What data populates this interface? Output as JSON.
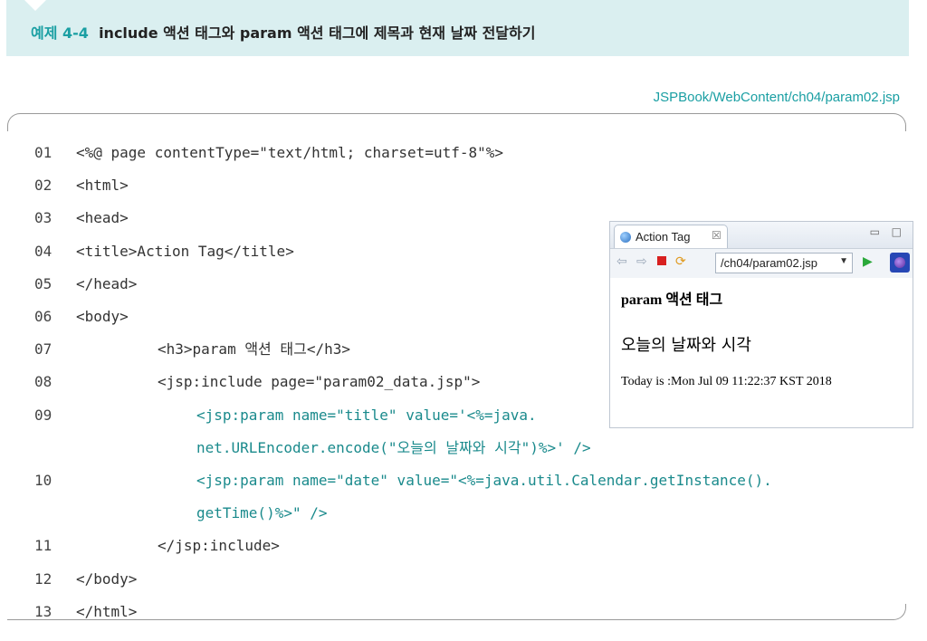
{
  "banner": {
    "number": "예제 4-4",
    "title": "include 액션 태그와 param 액션 태그에 제목과 현재 날짜 전달하기"
  },
  "file_path": "JSPBook/WebContent/ch04/param02.jsp",
  "code_lines": [
    {
      "num": "01",
      "text": "<%@ page contentType=\"text/html; charset=utf-8\"%>",
      "indent": 0,
      "teal": false
    },
    {
      "num": "02",
      "text": "<html>",
      "indent": 0,
      "teal": false
    },
    {
      "num": "03",
      "text": "<head>",
      "indent": 0,
      "teal": false
    },
    {
      "num": "04",
      "text": "<title>Action Tag</title>",
      "indent": 0,
      "teal": false
    },
    {
      "num": "05",
      "text": "</head>",
      "indent": 0,
      "teal": false
    },
    {
      "num": "06",
      "text": "<body>",
      "indent": 0,
      "teal": false
    },
    {
      "num": "07",
      "text": "<h3>param 액션 태그</h3>",
      "indent": 1,
      "teal": false
    },
    {
      "num": "08",
      "text": "<jsp:include page=\"param02_data.jsp\">",
      "indent": 1,
      "teal": false
    },
    {
      "num": "09",
      "text": "<jsp:param name=\"title\" value='<%=java.",
      "indent": 2,
      "teal": true
    },
    {
      "num": "",
      "text": "net.URLEncoder.encode(\"오늘의 날짜와 시각\")%>' />",
      "indent": 2,
      "teal": true
    },
    {
      "num": "10",
      "text": "<jsp:param name=\"date\" value=\"<%=java.util.Calendar.getInstance().",
      "indent": 2,
      "teal": true
    },
    {
      "num": "",
      "text": "getTime()%>\" />",
      "indent": 2,
      "teal": true
    },
    {
      "num": "11",
      "text": "</jsp:include>",
      "indent": 1,
      "teal": false
    },
    {
      "num": "12",
      "text": "</body>",
      "indent": 0,
      "teal": false
    },
    {
      "num": "13",
      "text": "</html>",
      "indent": 0,
      "teal": false
    }
  ],
  "browser": {
    "tab_label": "Action Tag",
    "tab_close": "☒",
    "url": "/ch04/param02.jsp",
    "content": {
      "heading": "param 액션 태그",
      "subheading": "오늘의 날짜와 시각",
      "today": "Today is :Mon Jul 09 11:22:37 KST 2018"
    }
  }
}
